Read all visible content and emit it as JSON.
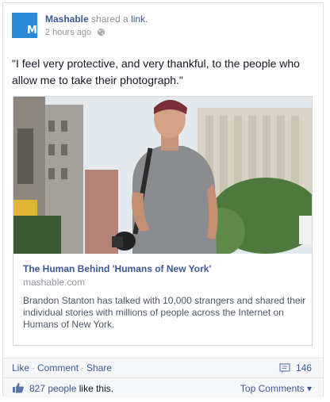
{
  "post": {
    "avatar_letter": "M",
    "actor_name": "Mashable",
    "shared_text": "shared a",
    "link_text": "link.",
    "timestamp": "2 hours ago",
    "privacy_icon": "globe-icon",
    "message": "\"I feel very protective, and very thankful, to the people who allow me to take their photograph.\""
  },
  "shared_link": {
    "title": "The Human Behind 'Humans of New York'",
    "domain": "mashable.com",
    "description": "Brandon Stanton has talked with 10,000 strangers and shared their individual stories with millions of people across the Internet on Humans of New York."
  },
  "actions": {
    "like": "Like",
    "comment": "Comment",
    "share": "Share",
    "separator": "·",
    "comment_count": "146"
  },
  "likes": {
    "count_text": "827 people",
    "suffix": "like this.",
    "top_comments": "Top Comments",
    "dropdown_caret": "▾"
  },
  "colors": {
    "brand_link": "#3b5998",
    "avatar_bg": "#2a8ad8",
    "secondary_text": "#90949c",
    "footer_bg": "#f6f7f9"
  }
}
